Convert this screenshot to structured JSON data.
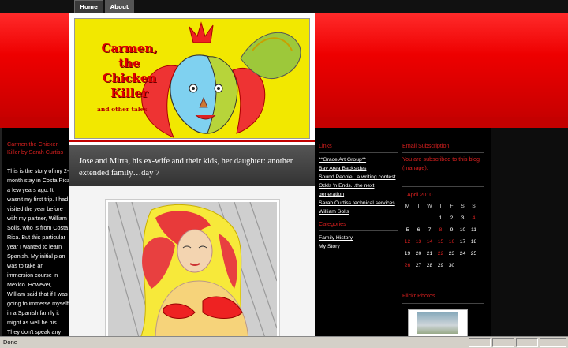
{
  "nav": {
    "home_label": "Home",
    "about_label": "About"
  },
  "header": {
    "title_lines": [
      "Carmen,",
      "the",
      "Chicken",
      "Killer"
    ],
    "tagline": "and other tales"
  },
  "left_sidebar": {
    "title": "Carmen the Chicken Killer by Sarah Curtiss",
    "body": "This is the story of my 2-month stay in Costa Rica a few years ago. It wasn't my first trip. I had visited the year before with my partner, William Solis, who is from Costa Rica. But this particular year I wanted to learn Spanish. My initial plan was to take an immersion course in Mexico. However, William said that if I was going to immerse myself in a Spanish family it might as well be his. They don't speak any English so I would be"
  },
  "post": {
    "title": "Jose and Mirta, his ex-wife and their kids, her daughter: another extended family…day 7"
  },
  "links": {
    "title": "Links",
    "items": [
      "**Grace Art Group**",
      "Bay Area Backsides",
      "Sound People...a writing contest",
      "Odds 'n Ends...the next generation",
      "Sarah Curtiss technical services",
      "William Solis"
    ]
  },
  "categories": {
    "title": "Categories",
    "items": [
      "Family History",
      "My Story"
    ]
  },
  "email": {
    "title": "Email Subscription",
    "text": "You are subscribed to this blog (manage)."
  },
  "calendar": {
    "title": "April 2010",
    "headers": [
      "M",
      "T",
      "W",
      "T",
      "F",
      "S",
      "S"
    ],
    "weeks": [
      [
        "",
        "",
        "",
        "1",
        "2",
        "3",
        "4"
      ],
      [
        "5",
        "6",
        "7",
        "8",
        "9",
        "10",
        "11"
      ],
      [
        "12",
        "13",
        "14",
        "15",
        "16",
        "17",
        "18"
      ],
      [
        "19",
        "20",
        "21",
        "22",
        "23",
        "24",
        "25"
      ],
      [
        "26",
        "27",
        "28",
        "29",
        "30",
        "",
        ""
      ]
    ],
    "post_days": [
      "4",
      "8",
      "12",
      "13",
      "14",
      "15",
      "16",
      "22",
      "26"
    ]
  },
  "flickr": {
    "title": "Flickr Photos"
  },
  "status": {
    "text": "Done"
  },
  "colors": {
    "accent_red": "#d8201f",
    "band_red": "#ee0000",
    "header_yellow": "#f2e800"
  }
}
